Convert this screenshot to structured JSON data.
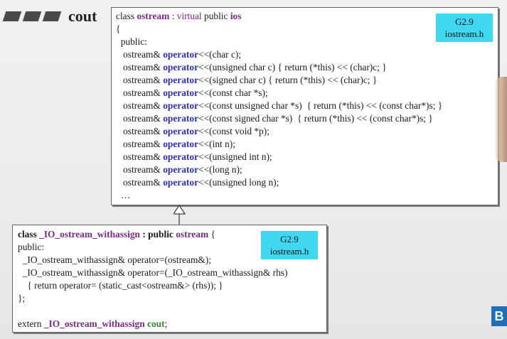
{
  "header": {
    "title": "cout"
  },
  "box1": {
    "badge": [
      "G2.9",
      "iostream.h"
    ],
    "lines": [
      [
        {
          "t": "class "
        },
        {
          "t": "ostream",
          "c": "kw-purple"
        },
        {
          "t": " : "
        },
        {
          "t": "virtual",
          "c": "kw-purple-n"
        },
        {
          "t": " public "
        },
        {
          "t": "ios",
          "c": "kw-purple"
        }
      ],
      [
        {
          "t": "{"
        }
      ],
      [
        {
          "t": "  public:"
        }
      ],
      [
        {
          "t": "   ostream& "
        },
        {
          "t": "operator",
          "c": "kw-blue"
        },
        {
          "t": "<<(char c);"
        }
      ],
      [
        {
          "t": "   ostream& "
        },
        {
          "t": "operator",
          "c": "kw-blue"
        },
        {
          "t": "<<(unsigned char c) { return (*this) << (char)c; }"
        }
      ],
      [
        {
          "t": "   ostream& "
        },
        {
          "t": "operator",
          "c": "kw-blue"
        },
        {
          "t": "<<(signed char c) { return (*this) << (char)c; }"
        }
      ],
      [
        {
          "t": "   ostream& "
        },
        {
          "t": "operator",
          "c": "kw-blue"
        },
        {
          "t": "<<(const char *s);"
        }
      ],
      [
        {
          "t": "   ostream& "
        },
        {
          "t": "operator",
          "c": "kw-blue"
        },
        {
          "t": "<<(const unsigned char *s)  { return (*this) << (const char*)s; }"
        }
      ],
      [
        {
          "t": "   ostream& "
        },
        {
          "t": "operator",
          "c": "kw-blue"
        },
        {
          "t": "<<(const signed char *s)  { return (*this) << (const char*)s; }"
        }
      ],
      [
        {
          "t": "   ostream& "
        },
        {
          "t": "operator",
          "c": "kw-blue"
        },
        {
          "t": "<<(const void *p);"
        }
      ],
      [
        {
          "t": "   ostream& "
        },
        {
          "t": "operator",
          "c": "kw-blue"
        },
        {
          "t": "<<(int n);"
        }
      ],
      [
        {
          "t": "   ostream& "
        },
        {
          "t": "operator",
          "c": "kw-blue"
        },
        {
          "t": "<<(unsigned int n);"
        }
      ],
      [
        {
          "t": "   ostream& "
        },
        {
          "t": "operator",
          "c": "kw-blue"
        },
        {
          "t": "<<(long n);"
        }
      ],
      [
        {
          "t": "   ostream& "
        },
        {
          "t": "operator",
          "c": "kw-blue"
        },
        {
          "t": "<<(unsigned long n);"
        }
      ],
      [
        {
          "t": "  …"
        }
      ]
    ]
  },
  "box2": {
    "badge": [
      "G2.9",
      "iostream.h"
    ],
    "lines": [
      [
        {
          "t": "class ",
          "c": "b"
        },
        {
          "t": "_IO_ostream_withassign",
          "c": "kw-purple"
        },
        {
          "t": " : public ",
          "c": "b"
        },
        {
          "t": "ostream",
          "c": "kw-purple"
        },
        {
          "t": " {"
        }
      ],
      [
        {
          "t": "public:"
        }
      ],
      [
        {
          "t": "  _IO_ostream_withassign& operator=(ostream&);"
        }
      ],
      [
        {
          "t": "  _IO_ostream_withassign& operator=(_IO_ostream_withassign& rhs)"
        }
      ],
      [
        {
          "t": "    { return operator= (static_cast<ostream&> (rhs)); }"
        }
      ],
      [
        {
          "t": "};"
        }
      ],
      [
        {
          "t": ""
        }
      ],
      [
        {
          "t": "extern "
        },
        {
          "t": "_IO_ostream_withassign",
          "c": "kw-purple"
        },
        {
          "t": " "
        },
        {
          "t": "cout",
          "c": "kw-green"
        },
        {
          "t": ";"
        }
      ]
    ]
  },
  "corner_label": "B"
}
